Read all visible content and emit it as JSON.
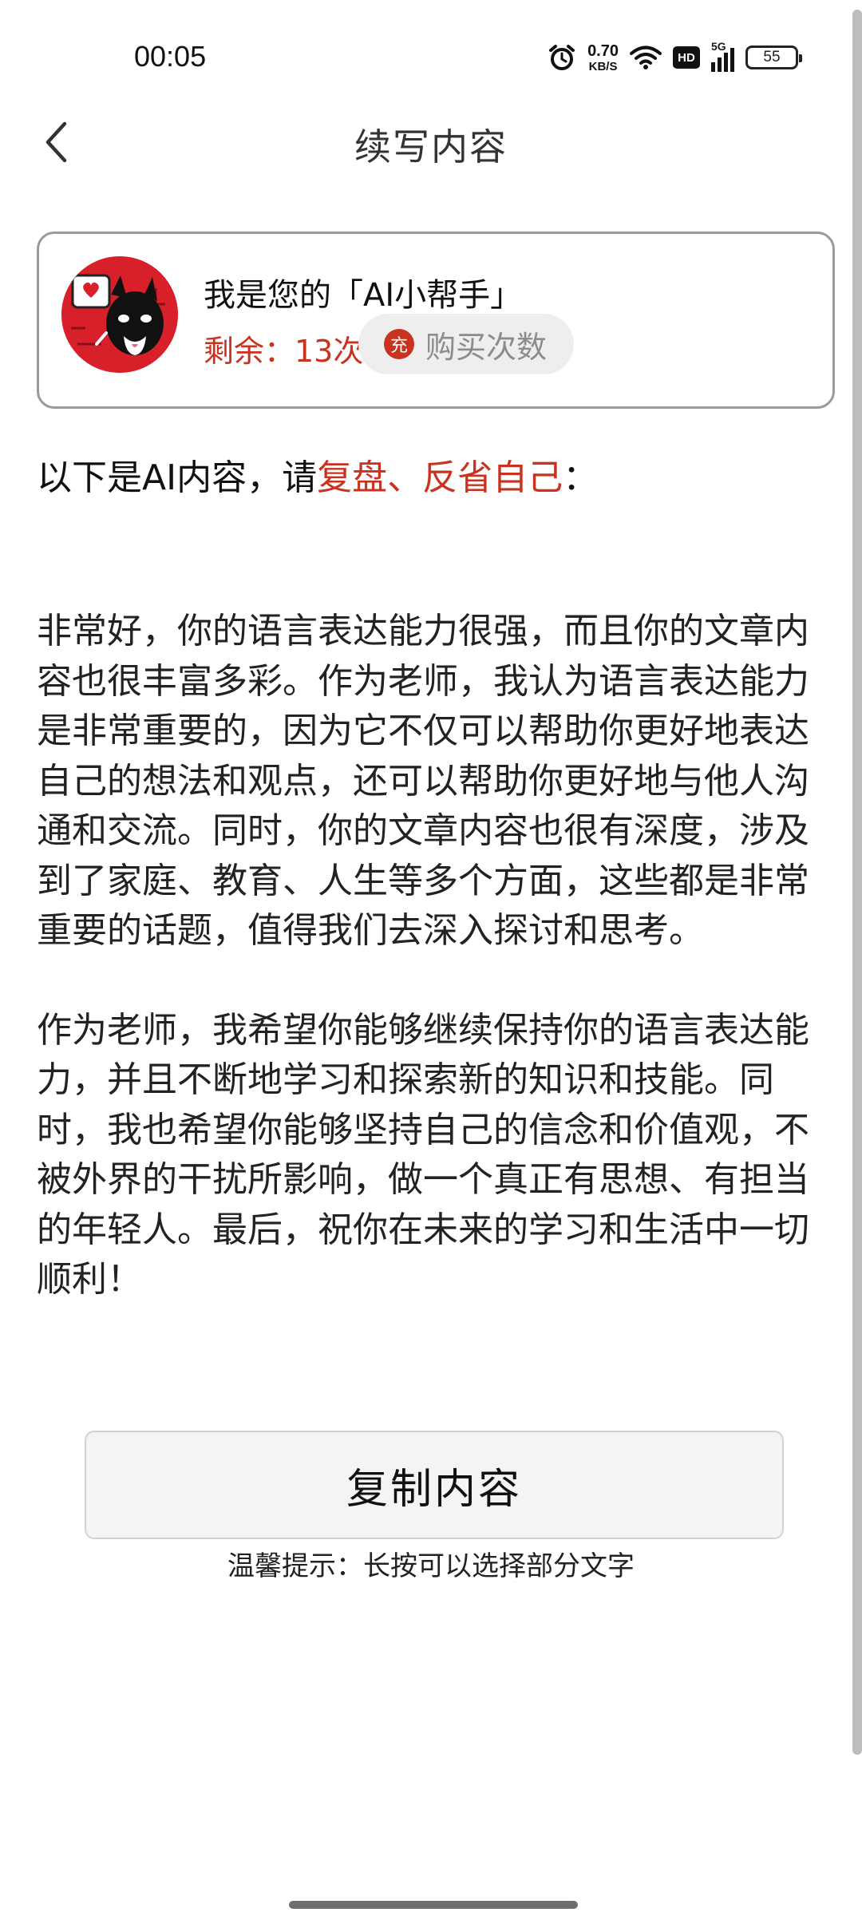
{
  "status_bar": {
    "time": "00:05",
    "net_speed_value": "0.70",
    "net_speed_unit": "KB/S",
    "hd_label": "HD",
    "signal_label": "5G",
    "battery": "55",
    "icons": [
      "alarm-icon",
      "wifi-icon",
      "hd-icon",
      "signal-5g-icon",
      "battery-icon"
    ]
  },
  "nav": {
    "title": "续写内容",
    "back_icon": "chevron-left-icon"
  },
  "assistant": {
    "title": "我是您的「AI小帮手」",
    "remaining": "剩余：13次",
    "buy_icon_char": "充",
    "buy_label": "购买次数"
  },
  "intro": {
    "prefix": "以下是AI内容，请",
    "highlight": "复盘、反省自己",
    "suffix": "："
  },
  "content": {
    "paragraph_1": "非常好，你的语言表达能力很强，而且你的文章内容也很丰富多彩。作为老师，我认为语言表达能力是非常重要的，因为它不仅可以帮助你更好地表达自己的想法和观点，还可以帮助你更好地与他人沟通和交流。同时，你的文章内容也很有深度，涉及到了家庭、教育、人生等多个方面，这些都是非常重要的话题，值得我们去深入探讨和思考。",
    "paragraph_2": "作为老师，我希望你能够继续保持你的语言表达能力，并且不断地学习和探索新的知识和技能。同时，我也希望你能够坚持自己的信念和价值观，不被外界的干扰所影响，做一个真正有思想、有担当的年轻人。最后，祝你在未来的学习和生活中一切顺利！"
  },
  "actions": {
    "copy_label": "复制内容",
    "tip": "温馨提示：长按可以选择部分文字"
  },
  "colors": {
    "accent_red": "#c8321e",
    "avatar_bg": "#d8202a"
  }
}
